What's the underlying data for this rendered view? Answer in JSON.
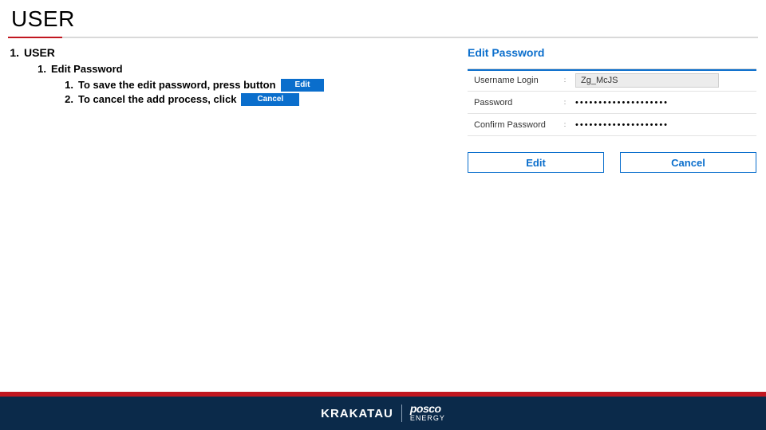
{
  "title": "USER",
  "outline": {
    "lvl1_num": "1.",
    "lvl1_text": "USER",
    "lvl2_num": "1.",
    "lvl2_text": "Edit Password",
    "lvl3a_num": "1.",
    "lvl3a_text": "To save the edit password, press button",
    "lvl3a_chip": "Edit",
    "lvl3b_num": "2.",
    "lvl3b_text": "To cancel the add process, click",
    "lvl3b_chip": "Cancel"
  },
  "panel": {
    "title": "Edit Password",
    "rows": {
      "username_label": "Username Login",
      "username_value": "Zg_McJS",
      "password_label": "Password",
      "password_value": "••••••••••••••••••••",
      "confirm_label": "Confirm Password",
      "confirm_value": "••••••••••••••••••••",
      "sep": ":"
    },
    "buttons": {
      "edit": "Edit",
      "cancel": "Cancel"
    }
  },
  "footer": {
    "brand1": "KRAKATAU",
    "brand2a": "posco",
    "brand2b": "ENERGY"
  }
}
